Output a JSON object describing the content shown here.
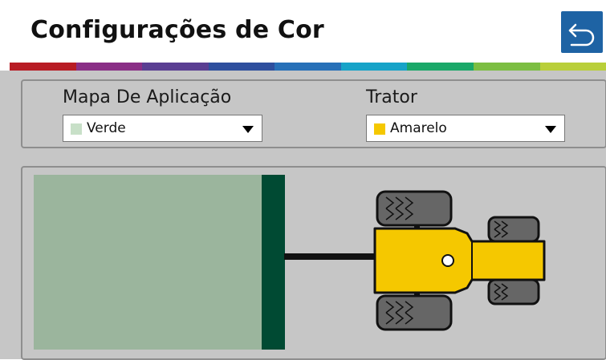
{
  "header": {
    "title": "Configurações de Cor",
    "back_icon": "undo-arrow-icon",
    "back_color": "#1e63a4"
  },
  "brand_strip_colors": [
    "#b81c24",
    "#8a2f86",
    "#5a3e92",
    "#2e4f9e",
    "#2770b8",
    "#17a3c8",
    "#1aa869",
    "#7cbe42",
    "#b9cf3a"
  ],
  "application_map": {
    "label": "Mapa De Aplicação",
    "selected": "Verde",
    "swatch_color": "#c8e0c8",
    "arrow_icon": "dropdown-arrow-icon"
  },
  "tractor": {
    "label": "Trator",
    "selected": "Amarelo",
    "swatch_color": "#f5c800",
    "arrow_icon": "dropdown-arrow-icon"
  },
  "preview": {
    "map_color": "#9bb59d",
    "implement_color": "#004a33",
    "tractor_color": "#f5c800",
    "tractor_icon": "tractor-icon"
  }
}
